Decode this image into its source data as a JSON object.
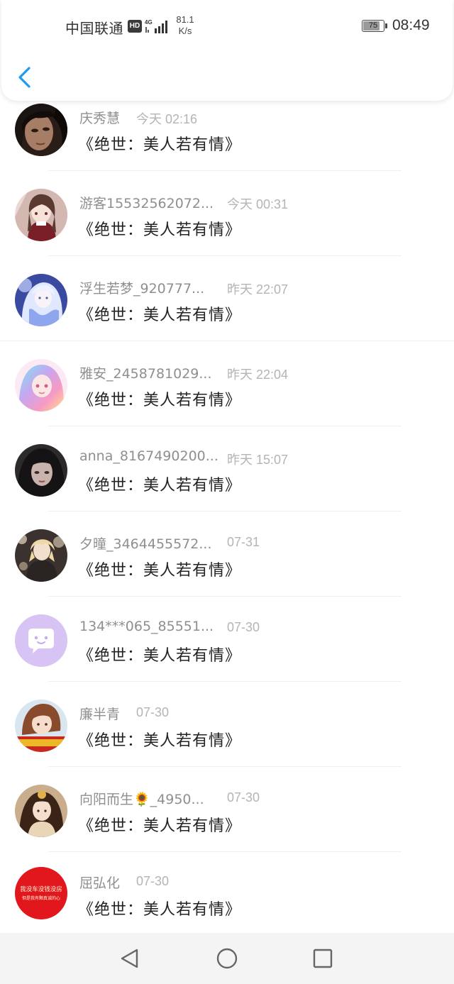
{
  "status_bar": {
    "carrier": "中国联通",
    "hd": "HD",
    "network": "4G",
    "speed_value": "81.1",
    "speed_unit": "K/s",
    "battery_level": "75",
    "time": "08:49"
  },
  "header": {
    "back_icon": "chevron-left-icon",
    "accent_color": "#1e9bf0"
  },
  "messages": [
    {
      "name": "庆秀慧",
      "time": "今天 02:16",
      "title": "《绝世：美人若有情》",
      "avatar": "dark-hair-portrait"
    },
    {
      "name": "游客15532562072...",
      "time": "今天 00:31",
      "title": "《绝世：美人若有情》",
      "avatar": "anime-girl-red"
    },
    {
      "name": "浮生若梦_920777...",
      "time": "昨天 22:07",
      "title": "《绝世：美人若有情》",
      "avatar": "anime-girl-blue"
    },
    {
      "name": "雅安_2458781029...",
      "time": "昨天 22:04",
      "title": "《绝世：美人若有情》",
      "avatar": "anime-girl-rainbow"
    },
    {
      "name": "anna_8167490200...",
      "time": "昨天 15:07",
      "title": "《绝世：美人若有情》",
      "avatar": "dark-portrait"
    },
    {
      "name": "夕曈_3464455572...",
      "time": "07-31",
      "title": "《绝世：美人若有情》",
      "avatar": "blond-anime-boy"
    },
    {
      "name": "134***065_85551...",
      "time": "07-30",
      "title": "《绝世：美人若有情》",
      "avatar": "default-chat-bubble"
    },
    {
      "name": "廉半青",
      "time": "07-30",
      "title": "《绝世：美人若有情》",
      "avatar": "anime-boy-banner"
    },
    {
      "name": "向阳而生🌻_4950...",
      "time": "07-30",
      "title": "《绝世：美人若有情》",
      "avatar": "ancient-costume-girl"
    },
    {
      "name": "屈弘化",
      "time": "07-30",
      "title": "《绝世：美人若有情》",
      "avatar": "red-text-badge",
      "avatar_text_1": "我没车没钱没房",
      "avatar_text_2": "但是我有颗真诚的心"
    }
  ],
  "nav_bar": {
    "back_icon": "triangle-back-icon",
    "home_icon": "circle-home-icon",
    "recents_icon": "square-recents-icon"
  }
}
